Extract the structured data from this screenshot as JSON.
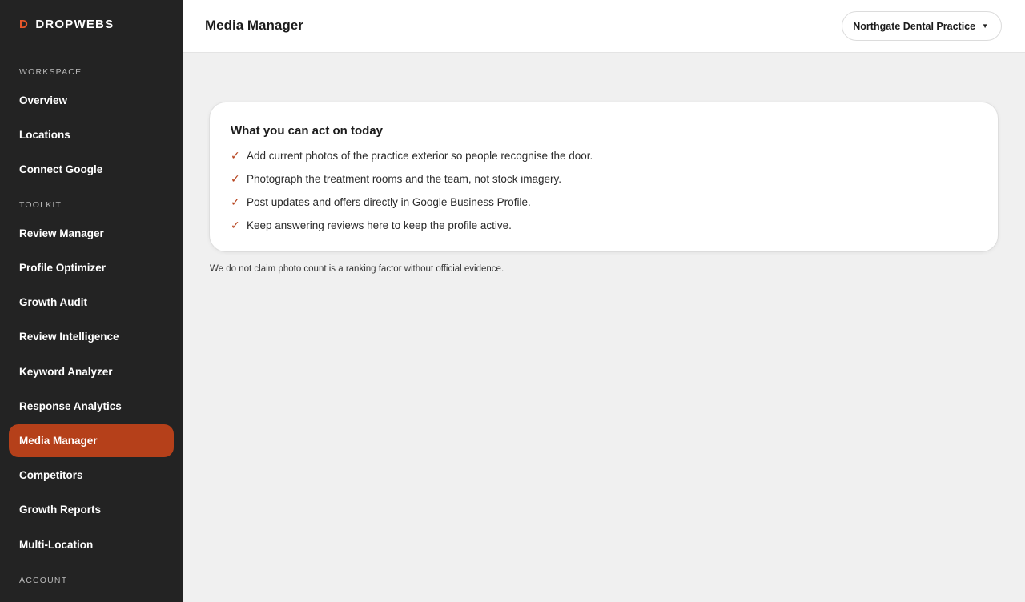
{
  "brand": {
    "mark": "D",
    "name": "DROPWEBS"
  },
  "sidebar": {
    "sections": {
      "workspace": "WORKSPACE",
      "toolkit": "TOOLKIT",
      "account": "ACCOUNT"
    },
    "items": [
      {
        "label": "Overview"
      },
      {
        "label": "Locations"
      },
      {
        "label": "Connect Google"
      },
      {
        "label": "Review Manager"
      },
      {
        "label": "Profile Optimizer"
      },
      {
        "label": "Growth Audit"
      },
      {
        "label": "Review Intelligence"
      },
      {
        "label": "Keyword Analyzer"
      },
      {
        "label": "Response Analytics"
      },
      {
        "label": "Media Manager"
      },
      {
        "label": "Competitors"
      },
      {
        "label": "Growth Reports"
      },
      {
        "label": "Multi-Location"
      }
    ],
    "active_item": "Media Manager"
  },
  "header": {
    "title": "Media Manager",
    "location_select": "Northgate Dental Practice"
  },
  "card": {
    "title": "What you can act on today",
    "items": [
      "Add current photos of the practice exterior so people recognise the door.",
      "Photograph the treatment rooms and the team, not stock imagery.",
      "Post updates and offers directly in Google Business Profile.",
      "Keep answering reviews here to keep the profile active."
    ]
  },
  "footnote": "We do not claim photo count is a ranking factor without official evidence.",
  "colors": {
    "accent": "#b5401a",
    "brand_mark": "#e8562a",
    "sidebar_bg": "#232323"
  }
}
